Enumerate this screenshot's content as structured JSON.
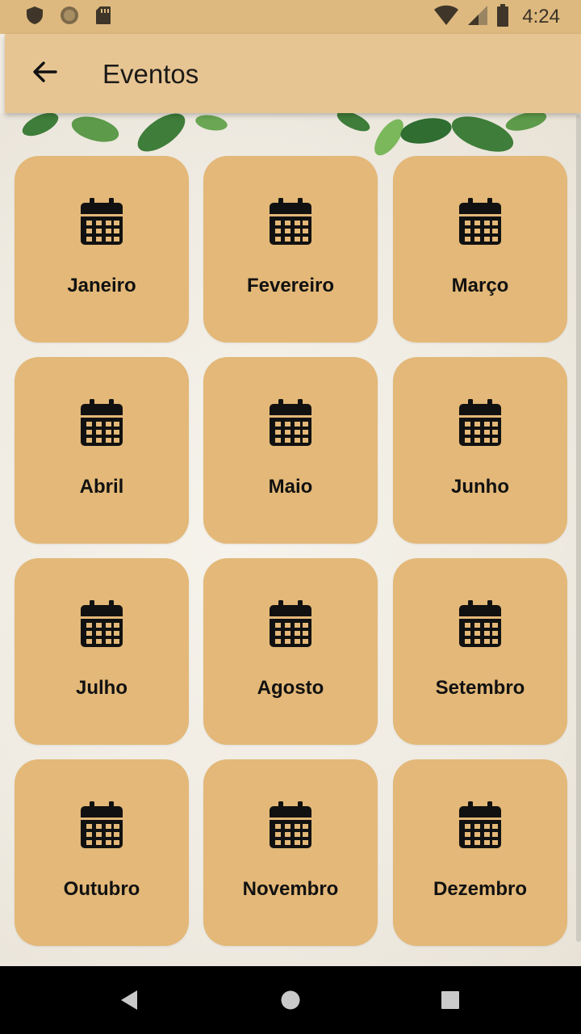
{
  "status_bar": {
    "time": "4:24",
    "icons": [
      "shield-icon",
      "sun-icon",
      "sd-card-icon",
      "wifi-icon",
      "signal-icon",
      "battery-icon"
    ]
  },
  "app_bar": {
    "back_icon": "arrow-left-icon",
    "title": "Eventos"
  },
  "months": [
    {
      "label": "Janeiro",
      "icon": "calendar-icon"
    },
    {
      "label": "Fevereiro",
      "icon": "calendar-icon"
    },
    {
      "label": "Março",
      "icon": "calendar-icon"
    },
    {
      "label": "Abril",
      "icon": "calendar-icon"
    },
    {
      "label": "Maio",
      "icon": "calendar-icon"
    },
    {
      "label": "Junho",
      "icon": "calendar-icon"
    },
    {
      "label": "Julho",
      "icon": "calendar-icon"
    },
    {
      "label": "Agosto",
      "icon": "calendar-icon"
    },
    {
      "label": "Setembro",
      "icon": "calendar-icon"
    },
    {
      "label": "Outubro",
      "icon": "calendar-icon"
    },
    {
      "label": "Novembro",
      "icon": "calendar-icon"
    },
    {
      "label": "Dezembro",
      "icon": "calendar-icon"
    }
  ],
  "nav_bar": {
    "icons": [
      "back-triangle-icon",
      "home-circle-icon",
      "recents-square-icon"
    ]
  },
  "colors": {
    "status_bar": "#deb97f",
    "app_bar": "#e7c593",
    "tile": "#e3b878",
    "background": "#f1ede4"
  }
}
